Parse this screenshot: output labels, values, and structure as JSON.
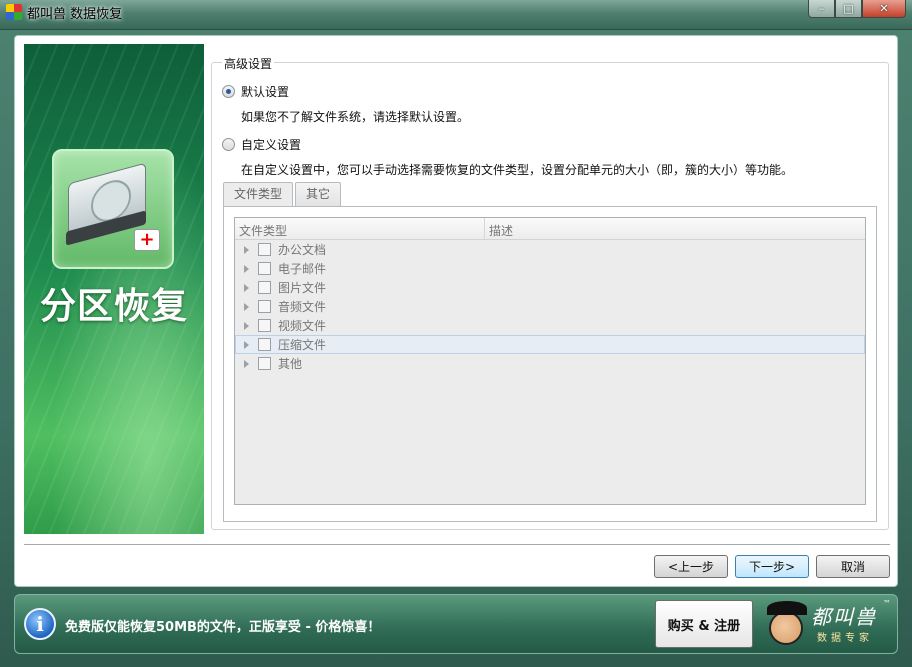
{
  "window": {
    "title": "都叫兽 数据恢复",
    "min_glyph": "–",
    "max_glyph": "□",
    "close_glyph": "✕"
  },
  "banner": {
    "title": "分区恢复"
  },
  "settings": {
    "legend": "高级设置",
    "default_option": {
      "label": "默认设置",
      "selected": true,
      "description": "如果您不了解文件系统，请选择默认设置。"
    },
    "custom_option": {
      "label": "自定义设置",
      "selected": false,
      "description": "在自定义设置中，您可以手动选择需要恢复的文件类型，设置分配单元的大小（即，簇的大小）等功能。"
    },
    "tabs": [
      {
        "label": "文件类型",
        "active": true
      },
      {
        "label": "其它",
        "active": false
      }
    ],
    "tree": {
      "columns": [
        "文件类型",
        "描述"
      ],
      "rows": [
        {
          "label": "办公文档",
          "checked": false
        },
        {
          "label": "电子邮件",
          "checked": false
        },
        {
          "label": "图片文件",
          "checked": false
        },
        {
          "label": "音频文件",
          "checked": false
        },
        {
          "label": "视频文件",
          "checked": false
        },
        {
          "label": "压缩文件",
          "checked": false,
          "highlighted": true
        },
        {
          "label": "其他",
          "checked": false
        }
      ]
    }
  },
  "nav": {
    "prev_label": "<上一步",
    "next_label": "下一步>",
    "cancel_label": "取消"
  },
  "infobar": {
    "icon": "info-icon",
    "message": "免费版仅能恢复50MB的文件，正版享受 - 价格惊喜！",
    "buy_label": "购买 & 注册",
    "logo_text": "都叫兽",
    "logo_sub": "数据专家",
    "logo_tm": "™"
  }
}
